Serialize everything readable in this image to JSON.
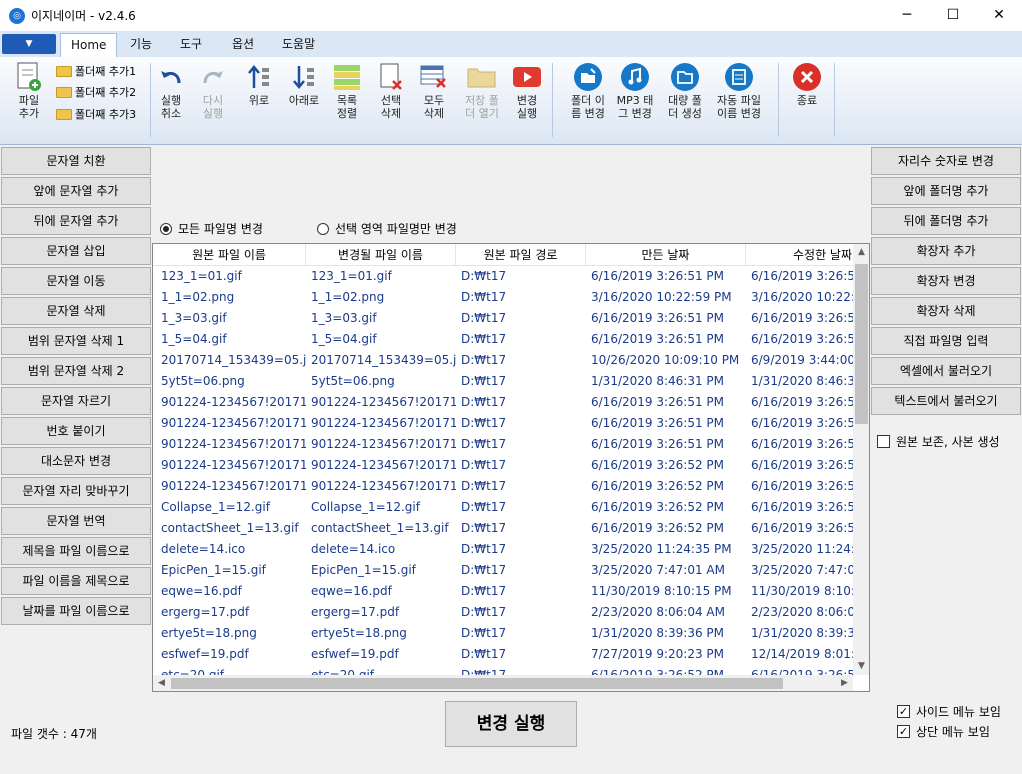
{
  "window": {
    "title": "이지네이머 - v2.4.6",
    "minimize": "─",
    "maximize": "☐",
    "close": "✕"
  },
  "menu_tabs": [
    "Home",
    "기능",
    "도구",
    "옵션",
    "도움말"
  ],
  "ribbon": {
    "add_file": "파일\n추가",
    "folders": [
      "폴더째 추가1",
      "폴더째 추가2",
      "폴더째 추가3"
    ],
    "undo": "실행\n취소",
    "redo": "다시\n실행",
    "up": "위로",
    "down": "아래로",
    "sort": "목록\n정렬",
    "delete_sel": "선택\n삭제",
    "delete_all": "모두\n삭제",
    "open_save": "저장 폴\n더 열기",
    "run": "변경\n실행",
    "folder_rename": "폴더 이\n름 변경",
    "mp3_tag": "MP3 태\n그 변경",
    "bulk_folder": "대량 폴\n더 생성",
    "auto_rename": "자동 파일\n이름 변경",
    "exit": "종료"
  },
  "left_menu": [
    "문자열 치환",
    "앞에 문자열 추가",
    "뒤에 문자열 추가",
    "문자열 삽입",
    "문자열 이동",
    "문자열 삭제",
    "범위 문자열 삭제 1",
    "범위 문자열 삭제 2",
    "문자열 자르기",
    "번호 붙이기",
    "대소문자 변경",
    "문자열 자리 맞바꾸기",
    "문자열 번역",
    "제목을 파일 이름으로",
    "파일 이름을 제목으로",
    "날짜를 파일 이름으로"
  ],
  "right_menu": [
    "자리수 숫자로 변경",
    "앞에 폴더명 추가",
    "뒤에 폴더명 추가",
    "확장자 추가",
    "확장자 변경",
    "확장자 삭제",
    "직접 파일명 입력",
    "엑셀에서 불러오기",
    "텍스트에서 불러오기"
  ],
  "right_option": "원본 보존, 사본 생성",
  "radio_all": "모든 파일명 변경",
  "radio_selection": "선택 영역 파일명만 변경",
  "columns": [
    "원본 파일 이름",
    "변경될 파일 이름",
    "원본 파일 경로",
    "만든 날짜",
    "수정한 날짜"
  ],
  "rows": [
    [
      "123_1=01.gif",
      "123_1=01.gif",
      "D:₩t17",
      "6/16/2019 3:26:51 PM",
      "6/16/2019 3:26:51"
    ],
    [
      "1_1=02.png",
      "1_1=02.png",
      "D:₩t17",
      "3/16/2020 10:22:59 PM",
      "3/16/2020 10:22:59"
    ],
    [
      "1_3=03.gif",
      "1_3=03.gif",
      "D:₩t17",
      "6/16/2019 3:26:51 PM",
      "6/16/2019 3:26:51"
    ],
    [
      "1_5=04.gif",
      "1_5=04.gif",
      "D:₩t17",
      "6/16/2019 3:26:51 PM",
      "6/16/2019 3:26:51"
    ],
    [
      "20170714_153439=05.jpg",
      "20170714_153439=05.jpg",
      "D:₩t17",
      "10/26/2020 10:09:10 PM",
      "6/9/2019 3:44:00 P"
    ],
    [
      "5yt5t=06.png",
      "5yt5t=06.png",
      "D:₩t17",
      "1/31/2020 8:46:31 PM",
      "1/31/2020 8:46:31"
    ],
    [
      "901224-1234567!2017101",
      "901224-1234567!2017101",
      "D:₩t17",
      "6/16/2019 3:26:51 PM",
      "6/16/2019 3:26:51"
    ],
    [
      "901224-1234567!2017101",
      "901224-1234567!2017101",
      "D:₩t17",
      "6/16/2019 3:26:51 PM",
      "6/16/2019 3:26:51"
    ],
    [
      "901224-1234567!2017101",
      "901224-1234567!2017101",
      "D:₩t17",
      "6/16/2019 3:26:51 PM",
      "6/16/2019 3:26:52"
    ],
    [
      "901224-1234567!2017101",
      "901224-1234567!2017101",
      "D:₩t17",
      "6/16/2019 3:26:52 PM",
      "6/16/2019 3:26:52"
    ],
    [
      "901224-1234567!2017101",
      "901224-1234567!2017101",
      "D:₩t17",
      "6/16/2019 3:26:52 PM",
      "6/16/2019 3:26:52"
    ],
    [
      "Collapse_1=12.gif",
      "Collapse_1=12.gif",
      "D:₩t17",
      "6/16/2019 3:26:52 PM",
      "6/16/2019 3:26:52"
    ],
    [
      "contactSheet_1=13.gif",
      "contactSheet_1=13.gif",
      "D:₩t17",
      "6/16/2019 3:26:52 PM",
      "6/16/2019 3:26:52"
    ],
    [
      "delete=14.ico",
      "delete=14.ico",
      "D:₩t17",
      "3/25/2020 11:24:35 PM",
      "3/25/2020 11:24:35"
    ],
    [
      "EpicPen_1=15.gif",
      "EpicPen_1=15.gif",
      "D:₩t17",
      "3/25/2020 7:47:01 AM",
      "3/25/2020 7:47:01"
    ],
    [
      "eqwe=16.pdf",
      "eqwe=16.pdf",
      "D:₩t17",
      "11/30/2019 8:10:15 PM",
      "11/30/2019 8:10:16"
    ],
    [
      "ergerg=17.pdf",
      "ergerg=17.pdf",
      "D:₩t17",
      "2/23/2020 8:06:04 AM",
      "2/23/2020 8:06:04"
    ],
    [
      "ertye5t=18.png",
      "ertye5t=18.png",
      "D:₩t17",
      "1/31/2020 8:39:36 PM",
      "1/31/2020 8:39:36"
    ],
    [
      "esfwef=19.pdf",
      "esfwef=19.pdf",
      "D:₩t17",
      "7/27/2019 9:20:23 PM",
      "12/14/2019 8:01:10"
    ],
    [
      "etc=20.gif",
      "etc=20.gif",
      "D:₩t17",
      "6/16/2019 3:26:52 PM",
      "6/16/2019 3:26:53"
    ]
  ],
  "file_count": "파일 갯수 : 47개",
  "exec_button": "변경 실행",
  "show_side_menu": "사이드 메뉴 보임",
  "show_top_menu": "상단 메뉴 보임",
  "colors": {
    "accent": "#1e5bb6",
    "ribbon_bg": "#dbe6f3",
    "grid_text": "#1a3a8a",
    "exit_red": "#d9302a"
  }
}
